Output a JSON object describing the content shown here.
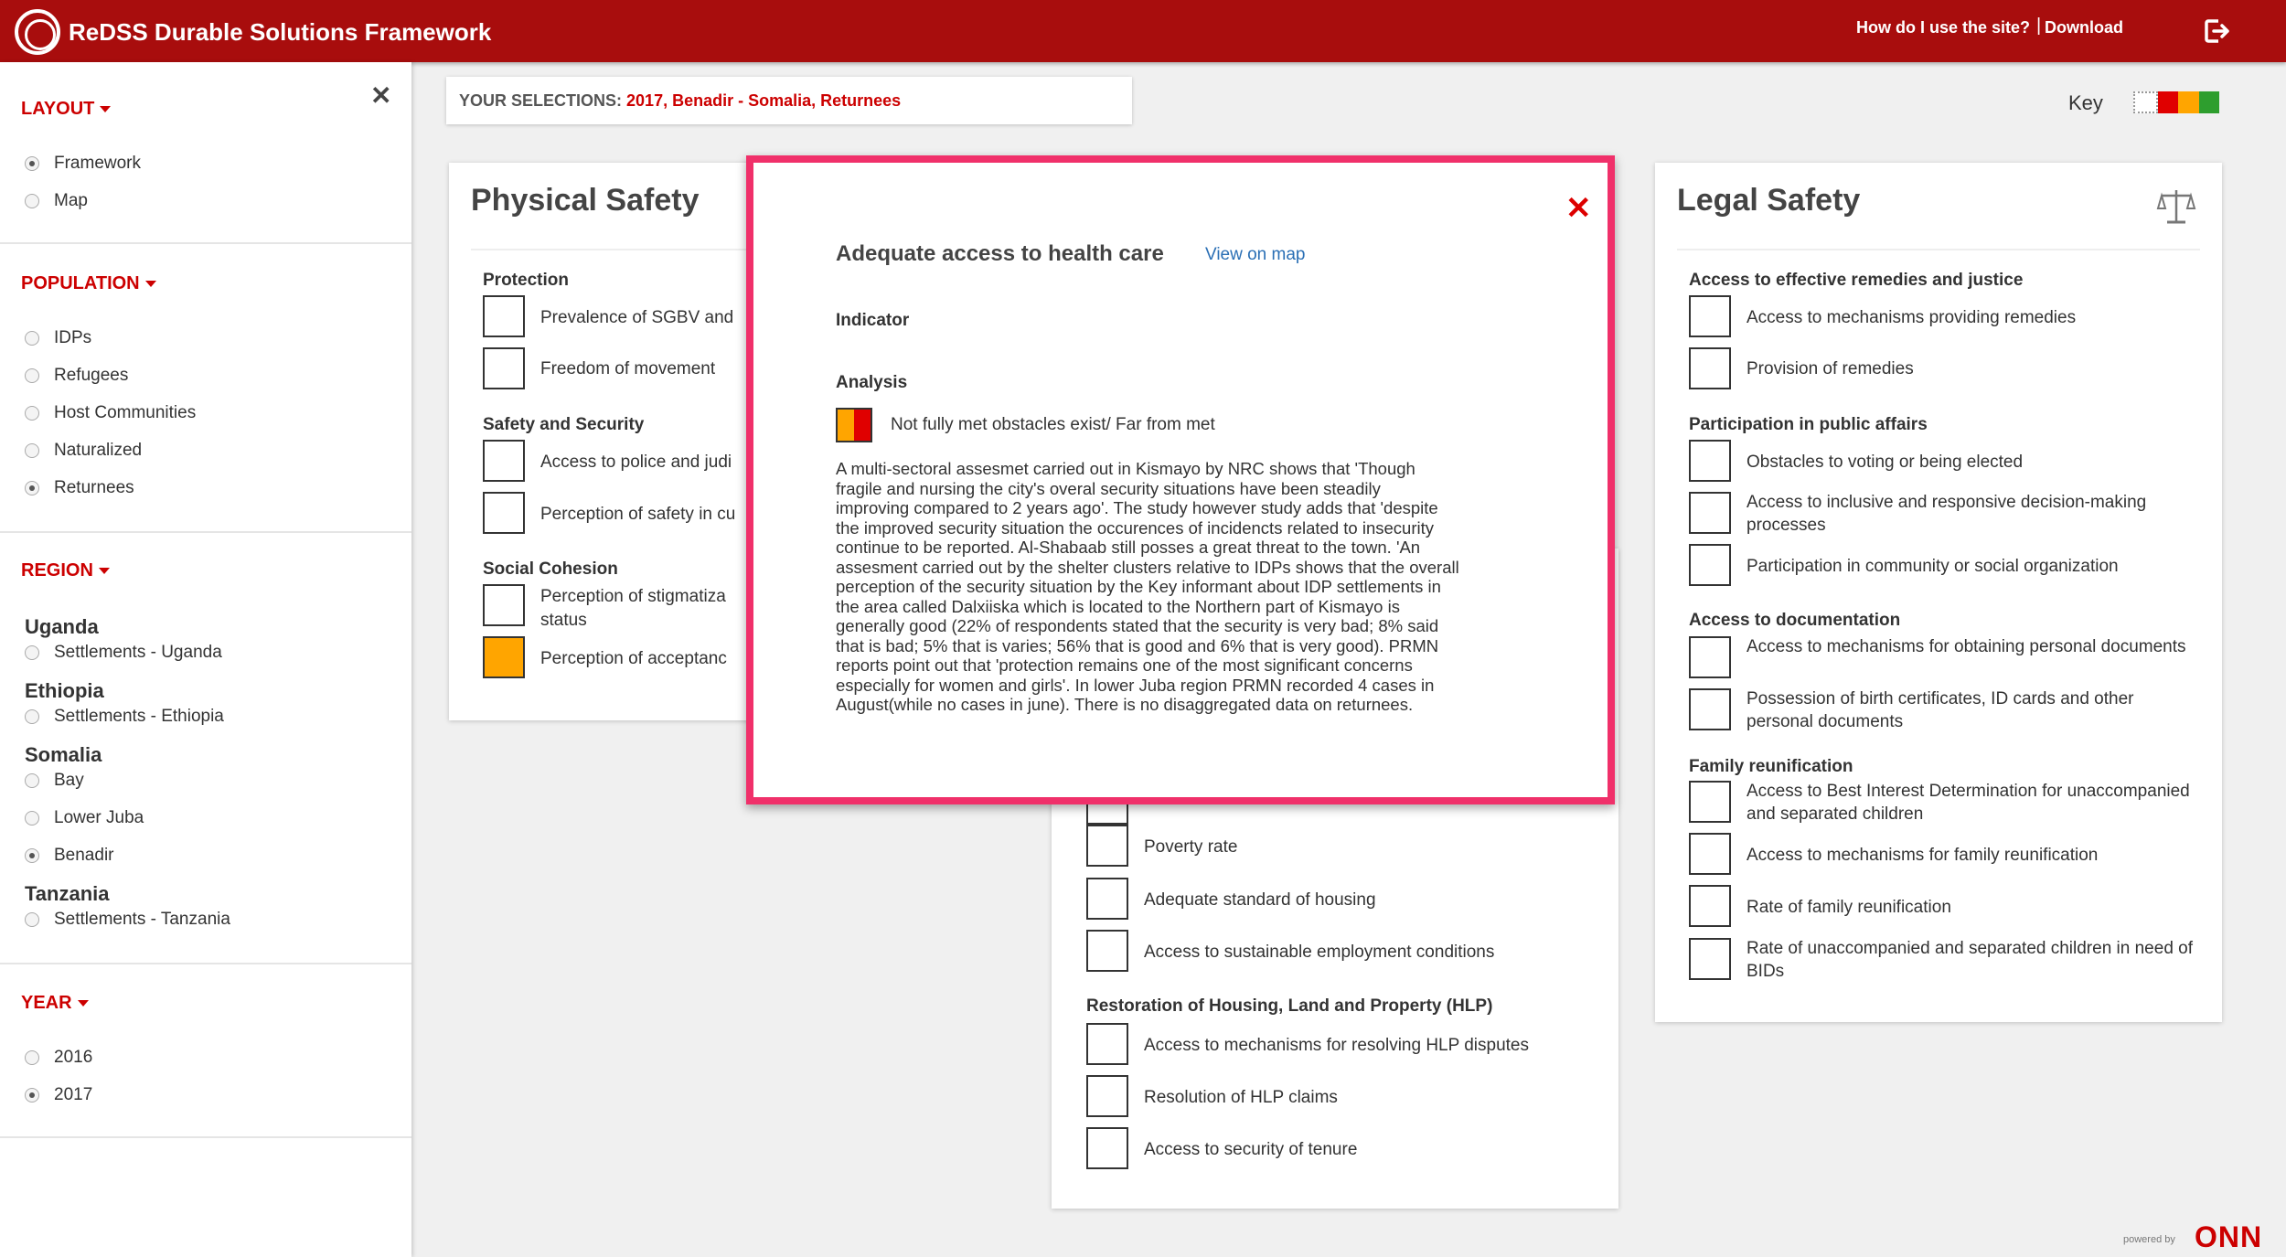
{
  "header": {
    "app_title": "ReDSS Durable Solutions Framework",
    "help_link": "How do I use the site?",
    "separator": "|",
    "download_link": "Download"
  },
  "sidebar": {
    "close_icon": "close-icon",
    "layout": {
      "heading": "LAYOUT",
      "options": [
        "Framework",
        "Map"
      ],
      "selected": "Framework"
    },
    "population": {
      "heading": "POPULATION",
      "options": [
        "IDPs",
        "Refugees",
        "Host Communities",
        "Naturalized",
        "Returnees"
      ],
      "selected": "Returnees"
    },
    "region": {
      "heading": "REGION",
      "groups": [
        {
          "name": "Uganda",
          "options": [
            "Settlements - Uganda"
          ]
        },
        {
          "name": "Ethiopia",
          "options": [
            "Settlements - Ethiopia"
          ]
        },
        {
          "name": "Somalia",
          "options": [
            "Bay",
            "Lower Juba",
            "Benadir"
          ]
        },
        {
          "name": "Tanzania",
          "options": [
            "Settlements - Tanzania"
          ]
        }
      ],
      "selected": "Benadir"
    },
    "year": {
      "heading": "YEAR",
      "options": [
        "2016",
        "2017"
      ],
      "selected": "2017"
    }
  },
  "selections": {
    "label": "YOUR SELECTIONS:",
    "value": "2017, Benadir - Somalia, Returnees"
  },
  "key": {
    "label": "Key",
    "colors": [
      "#ffffff",
      "#e00000",
      "#ffa500",
      "#2e9e2e"
    ]
  },
  "physical_safety": {
    "title": "Physical Safety",
    "groups": [
      {
        "title": "Protection",
        "items": [
          "Prevalence of SGBV and",
          "Freedom of movement"
        ]
      },
      {
        "title": "Safety and Security",
        "items": [
          "Access to police and judi",
          "Perception of safety in cu"
        ]
      },
      {
        "title": "Social Cohesion",
        "items": [
          "Perception of stigmatiza",
          "status",
          "Perception of acceptanc"
        ]
      }
    ],
    "item_colors": [
      "#ffffff",
      "#ffffff",
      "#ffffff",
      "#ffffff",
      "#ffffff",
      "#ffa500"
    ]
  },
  "material_safety": {
    "items": [
      "Poverty rate",
      "Adequate standard of housing",
      "Access to sustainable employment conditions"
    ],
    "hlp_group": {
      "title": "Restoration of Housing, Land and Property (HLP)",
      "items": [
        "Access to mechanisms for resolving HLP disputes",
        "Resolution of HLP claims",
        "Access to security of tenure"
      ]
    }
  },
  "legal_safety": {
    "title": "Legal Safety",
    "icon": "scales-icon",
    "groups": [
      {
        "title": "Access to effective remedies and justice",
        "items": [
          "Access to mechanisms providing remedies",
          "Provision of remedies"
        ]
      },
      {
        "title": "Participation in public affairs",
        "items": [
          "Obstacles to voting or being elected",
          "Access to inclusive and responsive decision-making processes",
          "Participation in community or social organization"
        ]
      },
      {
        "title": "Access to documentation",
        "items": [
          "Access to mechanisms for obtaining personal documents",
          "Possession of birth certificates, ID cards and other personal documents"
        ]
      },
      {
        "title": "Family reunification",
        "items": [
          "Access to Best Interest Determination for unaccompanied and separated children",
          "Access to mechanisms for family reunification",
          "Rate of family reunification",
          "Rate of unaccompanied and separated children in need of BIDs"
        ]
      }
    ]
  },
  "modal": {
    "title": "Adequate access to health care",
    "view_on_map": "View on map",
    "indicator_label": "Indicator",
    "analysis_label": "Analysis",
    "status_colors": [
      "#ffa500",
      "#e00000"
    ],
    "status_text": "Not fully met obstacles exist/ Far from met",
    "analysis_lines": [
      "A multi-sectoral assesmet carried out in Kismayo by NRC shows that 'Though",
      "fragile and nursing the city's overal security situations have been steadily",
      "improving compared to 2 years ago'. The study however study adds that 'despite",
      "the improved security situation the occurences of incidencts related to insecurity",
      "continue to be reported. Al-Shabaab still posses a great threat to the town. 'An",
      "assesment carried out by the shelter clusters relative to IDPs shows that the overall",
      "perception of the security situation by the Key informant about IDP settlements in",
      "the area called Dalxiiska which is located to the Northern part of Kismayo is",
      "generally good (22% of respondents stated that the security is very bad; 8% said",
      "that is bad; 5% that is varies; 56% that is good and 6% that is very good). PRMN",
      "reports point out that 'protection remains one of the most significant concerns",
      "especially for women and girls'. In lower Juba region PRMN recorded 4 cases in",
      "August(while no cases in june). There is no disaggregated data on returnees."
    ]
  },
  "footer": {
    "powered_by": "powered by",
    "brand": "ONN"
  }
}
